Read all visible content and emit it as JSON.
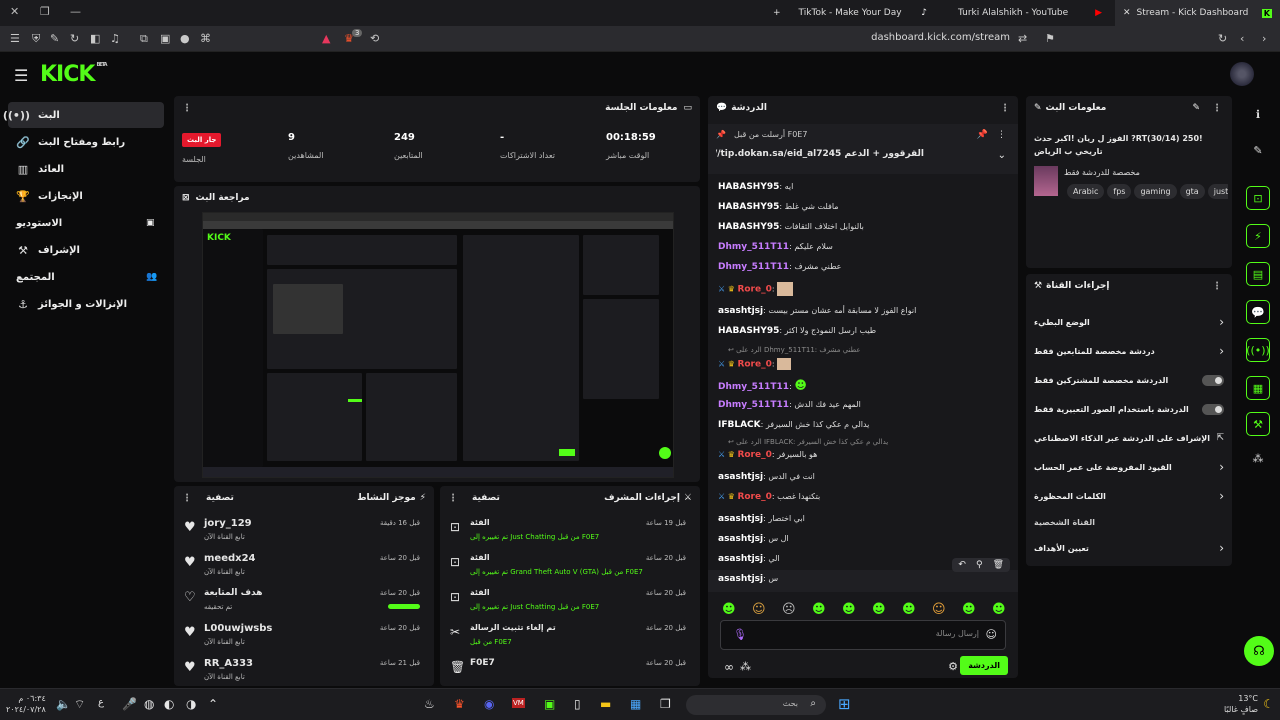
{
  "browser": {
    "tabs": [
      {
        "label": "TikTok - Make Your Day"
      },
      {
        "label": "Turki Alalshikh - YouTube"
      },
      {
        "label": "Stream - Kick Dashboard"
      }
    ],
    "new_tab": "+",
    "url": "dashboard.kick.com/stream",
    "brave_badge": "3"
  },
  "kick": {
    "logo": "KICK",
    "logo_tag": "BETA"
  },
  "nav": [
    {
      "label": "البث",
      "icon": "live-icon",
      "active": true
    },
    {
      "label": "رابط ومفتاح البث",
      "icon": "link-icon"
    },
    {
      "label": "العائد",
      "icon": "revenue-icon"
    },
    {
      "label": "الإنجازات",
      "icon": "achievement-icon"
    },
    {
      "label": "الاستوديو",
      "icon": "studio-icon"
    },
    {
      "label": "الإشراف",
      "icon": "moderation-icon"
    },
    {
      "label": "المجتمع",
      "icon": "community-icon"
    },
    {
      "label": "الإنزالات و الجوائز",
      "icon": "drops-icon"
    }
  ],
  "session": {
    "title": "معلومات الجلسة",
    "live_badge": "جار البث",
    "session_label": "الجلسة",
    "stats": [
      {
        "value": "00:18:59",
        "label": "الوقت مباشر"
      },
      {
        "value": "-",
        "label": "تعداد الاشتراكات"
      },
      {
        "value": "249",
        "label": "المتابعين"
      },
      {
        "value": "9",
        "label": "المشاهدين"
      }
    ]
  },
  "review": {
    "title": "مراجعة البث"
  },
  "activity": {
    "title": "موجز النشاط",
    "filter": "تصفية",
    "items": [
      {
        "user": "jory_129",
        "sub": "تابع القناة الآن",
        "time": "قبل 16 دقيقة"
      },
      {
        "user": "meedx24",
        "sub": "تابع القناة الآن",
        "time": "قبل 20 ساعة"
      },
      {
        "user": "هدف المتابعة",
        "sub": "تم تحقيقه",
        "time": "قبل 20 ساعة"
      },
      {
        "user": "L00uwjwsbs",
        "sub": "تابع القناة الآن",
        "time": "قبل 20 ساعة"
      },
      {
        "user": "RR_A333",
        "sub": "تابع القناة الآن",
        "time": "قبل 21 ساعة"
      }
    ]
  },
  "mod_actions": {
    "title": "إجراءات المشرف",
    "filter": "تصفية",
    "items": [
      {
        "title": "الفئة",
        "sub": "تم تغييره إلى Just Chatting من قبل F0E7",
        "time": "قبل 19 ساعة"
      },
      {
        "title": "الفئة",
        "sub": "تم تغييره إلى Grand Theft Auto V (GTA) من قبل F0E7",
        "time": "قبل 20 ساعة"
      },
      {
        "title": "الفئة",
        "sub": "تم تغييره إلى Just Chatting من قبل F0E7",
        "time": "قبل 20 ساعة"
      },
      {
        "title": "تم إلغاء تثبيت الرسالة",
        "sub": "من قبل F0E7",
        "time": "قبل 20 ساعة"
      },
      {
        "title": "F0E7",
        "sub": "",
        "time": "قبل 20 ساعة"
      }
    ]
  },
  "chat": {
    "title": "الدردشة",
    "pinned_by": "أرسلت من قبل F0E7",
    "pinned_text": "القرقوور + الدعم https://tip.dokan.sa/eid_al7245",
    "messages": [
      {
        "user": "HABASHY95",
        "text": "ايه"
      },
      {
        "user": "HABASHY95",
        "text": "مافلت شي غلط"
      },
      {
        "user": "HABASHY95",
        "text": "بالنوايل اختلاف الثقافات"
      },
      {
        "user": "Dhmy_511T11",
        "text": "سلام عليكم"
      },
      {
        "user": "Dhmy_511T11",
        "text": "عطني مشرف"
      },
      {
        "user": "Rore_0",
        "text": ""
      },
      {
        "user": "asashtjsj",
        "text": "انواع الفوز لا مسابقة أمه عشان مستر بيست"
      },
      {
        "user": "HABASHY95",
        "text": "طيب ارسل النموذج ولا اكثر"
      },
      {
        "user": "Rore_0",
        "text": ""
      },
      {
        "user": "Dhmy_511T11",
        "text": ""
      },
      {
        "user": "Dhmy_511T11",
        "text": "المهم عيد فك الدش"
      },
      {
        "user": "IFBLACK",
        "text": "يدالي م عكي كذا خش السيرفر"
      },
      {
        "user": "Rore_0",
        "text": "هو بالسيرفر"
      },
      {
        "user": "asashtjsj",
        "text": "انت في الدس"
      },
      {
        "user": "Rore_0",
        "text": "بتكنهدا غصب"
      },
      {
        "user": "asashtjsj",
        "text": "ابي اختصار"
      },
      {
        "user": "asashtjsj",
        "text": "ال س"
      },
      {
        "user": "asashtjsj",
        "text": "الي"
      },
      {
        "user": "asashtjsj",
        "text": "س"
      }
    ],
    "replies": [
      "الرد على Dhmy_511T11: عطني مشرف",
      "الرد على IFBLACK: يدالي م عكي كذا خش السيرفر"
    ],
    "input_placeholder": "إرسال رسالة",
    "send_label": "الدردشة"
  },
  "stream_info": {
    "title": "معلومات البث",
    "stream_title": "!RT(30/14) 250? الفوز ل ريان !اكبر حدث تاريخي ب الرياض",
    "category": "مخصصة للدردشة فقط",
    "tags": [
      "Arabic",
      "fps",
      "gaming",
      "gta",
      "just"
    ]
  },
  "channel_actions": {
    "title": "إجراءات القناة",
    "items": [
      {
        "label": "الوضع البطيء",
        "control": "chevron"
      },
      {
        "label": "دردشة مخصصة للمتابعين فقط",
        "control": "chevron"
      },
      {
        "label": "الدردشة مخصصة للمشتركين فقط",
        "control": "toggle"
      },
      {
        "label": "الدردشة باستخدام الصور التعبيرية فقط",
        "control": "toggle"
      },
      {
        "label": "الإشراف على الدردشة عبر الذكاء الاصطناعي",
        "control": "link"
      },
      {
        "label": "القيود المفروضة على عمر الحساب",
        "control": "chevron"
      },
      {
        "label": "الكلمات المحظورة",
        "control": "chevron"
      }
    ],
    "section": "القناة الشخصية",
    "goals": "تعيين الأهداف"
  },
  "taskbar": {
    "search_placeholder": "بحث",
    "time": "٠٦:٣٤ م",
    "date": "٢٠٢٤/٠٧/٢٨",
    "weather_temp": "13°C",
    "weather_desc": "صافٍ غالبًا",
    "lang": "ع"
  },
  "colors": {
    "accent": "#53fc18",
    "live": "#e5192d",
    "bg": "#0b0b0c",
    "panel": "#18181b"
  }
}
